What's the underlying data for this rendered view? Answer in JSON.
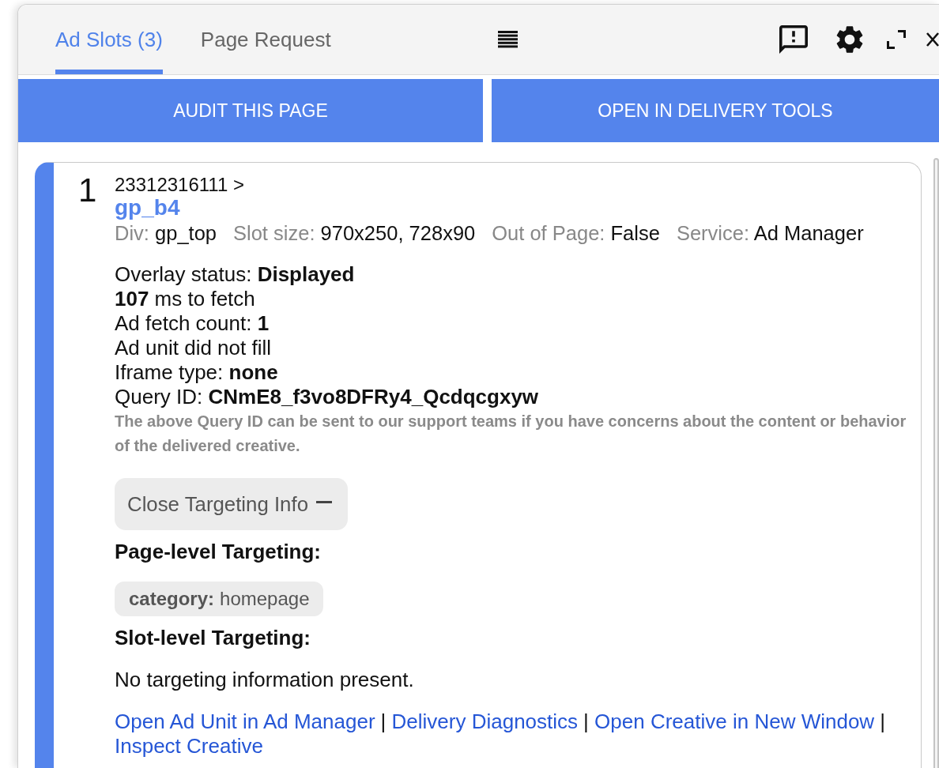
{
  "tabs": [
    {
      "label": "Ad Slots (3)",
      "selected": true
    },
    {
      "label": "Page Request",
      "selected": false
    }
  ],
  "actions": [
    "AUDIT THIS PAGE",
    "OPEN IN DELIVERY TOOLS"
  ],
  "slots": [
    {
      "index": "1",
      "ad_unit_path": "23312316111 >",
      "slot_name": "gp_b4",
      "properties": [
        {
          "label": "Div:",
          "value": "gp_top"
        },
        {
          "label": "Slot size:",
          "value": "970x250, 728x90"
        },
        {
          "label": "Out of Page:",
          "value": "False"
        },
        {
          "label": "Service:",
          "value": "Ad Manager"
        }
      ],
      "details": [
        "Overlay status: **Displayed**",
        "**107** ms to fetch",
        "Ad fetch count: **1**",
        "Ad unit did not fill",
        "Iframe type: **none**",
        "Query ID: **CNmE8_f3vo8DFRy4_Qcdqcgxyw**"
      ],
      "note": "The above Query ID can be sent to our support teams if you have concerns about the content or behavior of the delivered creative.",
      "targeting_toggle": {
        "label": "Close Targeting Info",
        "expanded": true
      },
      "page_targeting": {
        "heading": "Page-level Targeting:",
        "chips": [
          {
            "key": "category:",
            "value": "homepage"
          }
        ]
      },
      "slot_targeting": {
        "heading": "Slot-level Targeting:",
        "empty_message": "No targeting information present."
      },
      "link_separator": "|",
      "links": [
        "Open Ad Unit in Ad Manager",
        "Delivery Diagnostics",
        "Open Creative in New Window",
        "Inspect Creative"
      ]
    }
  ]
}
